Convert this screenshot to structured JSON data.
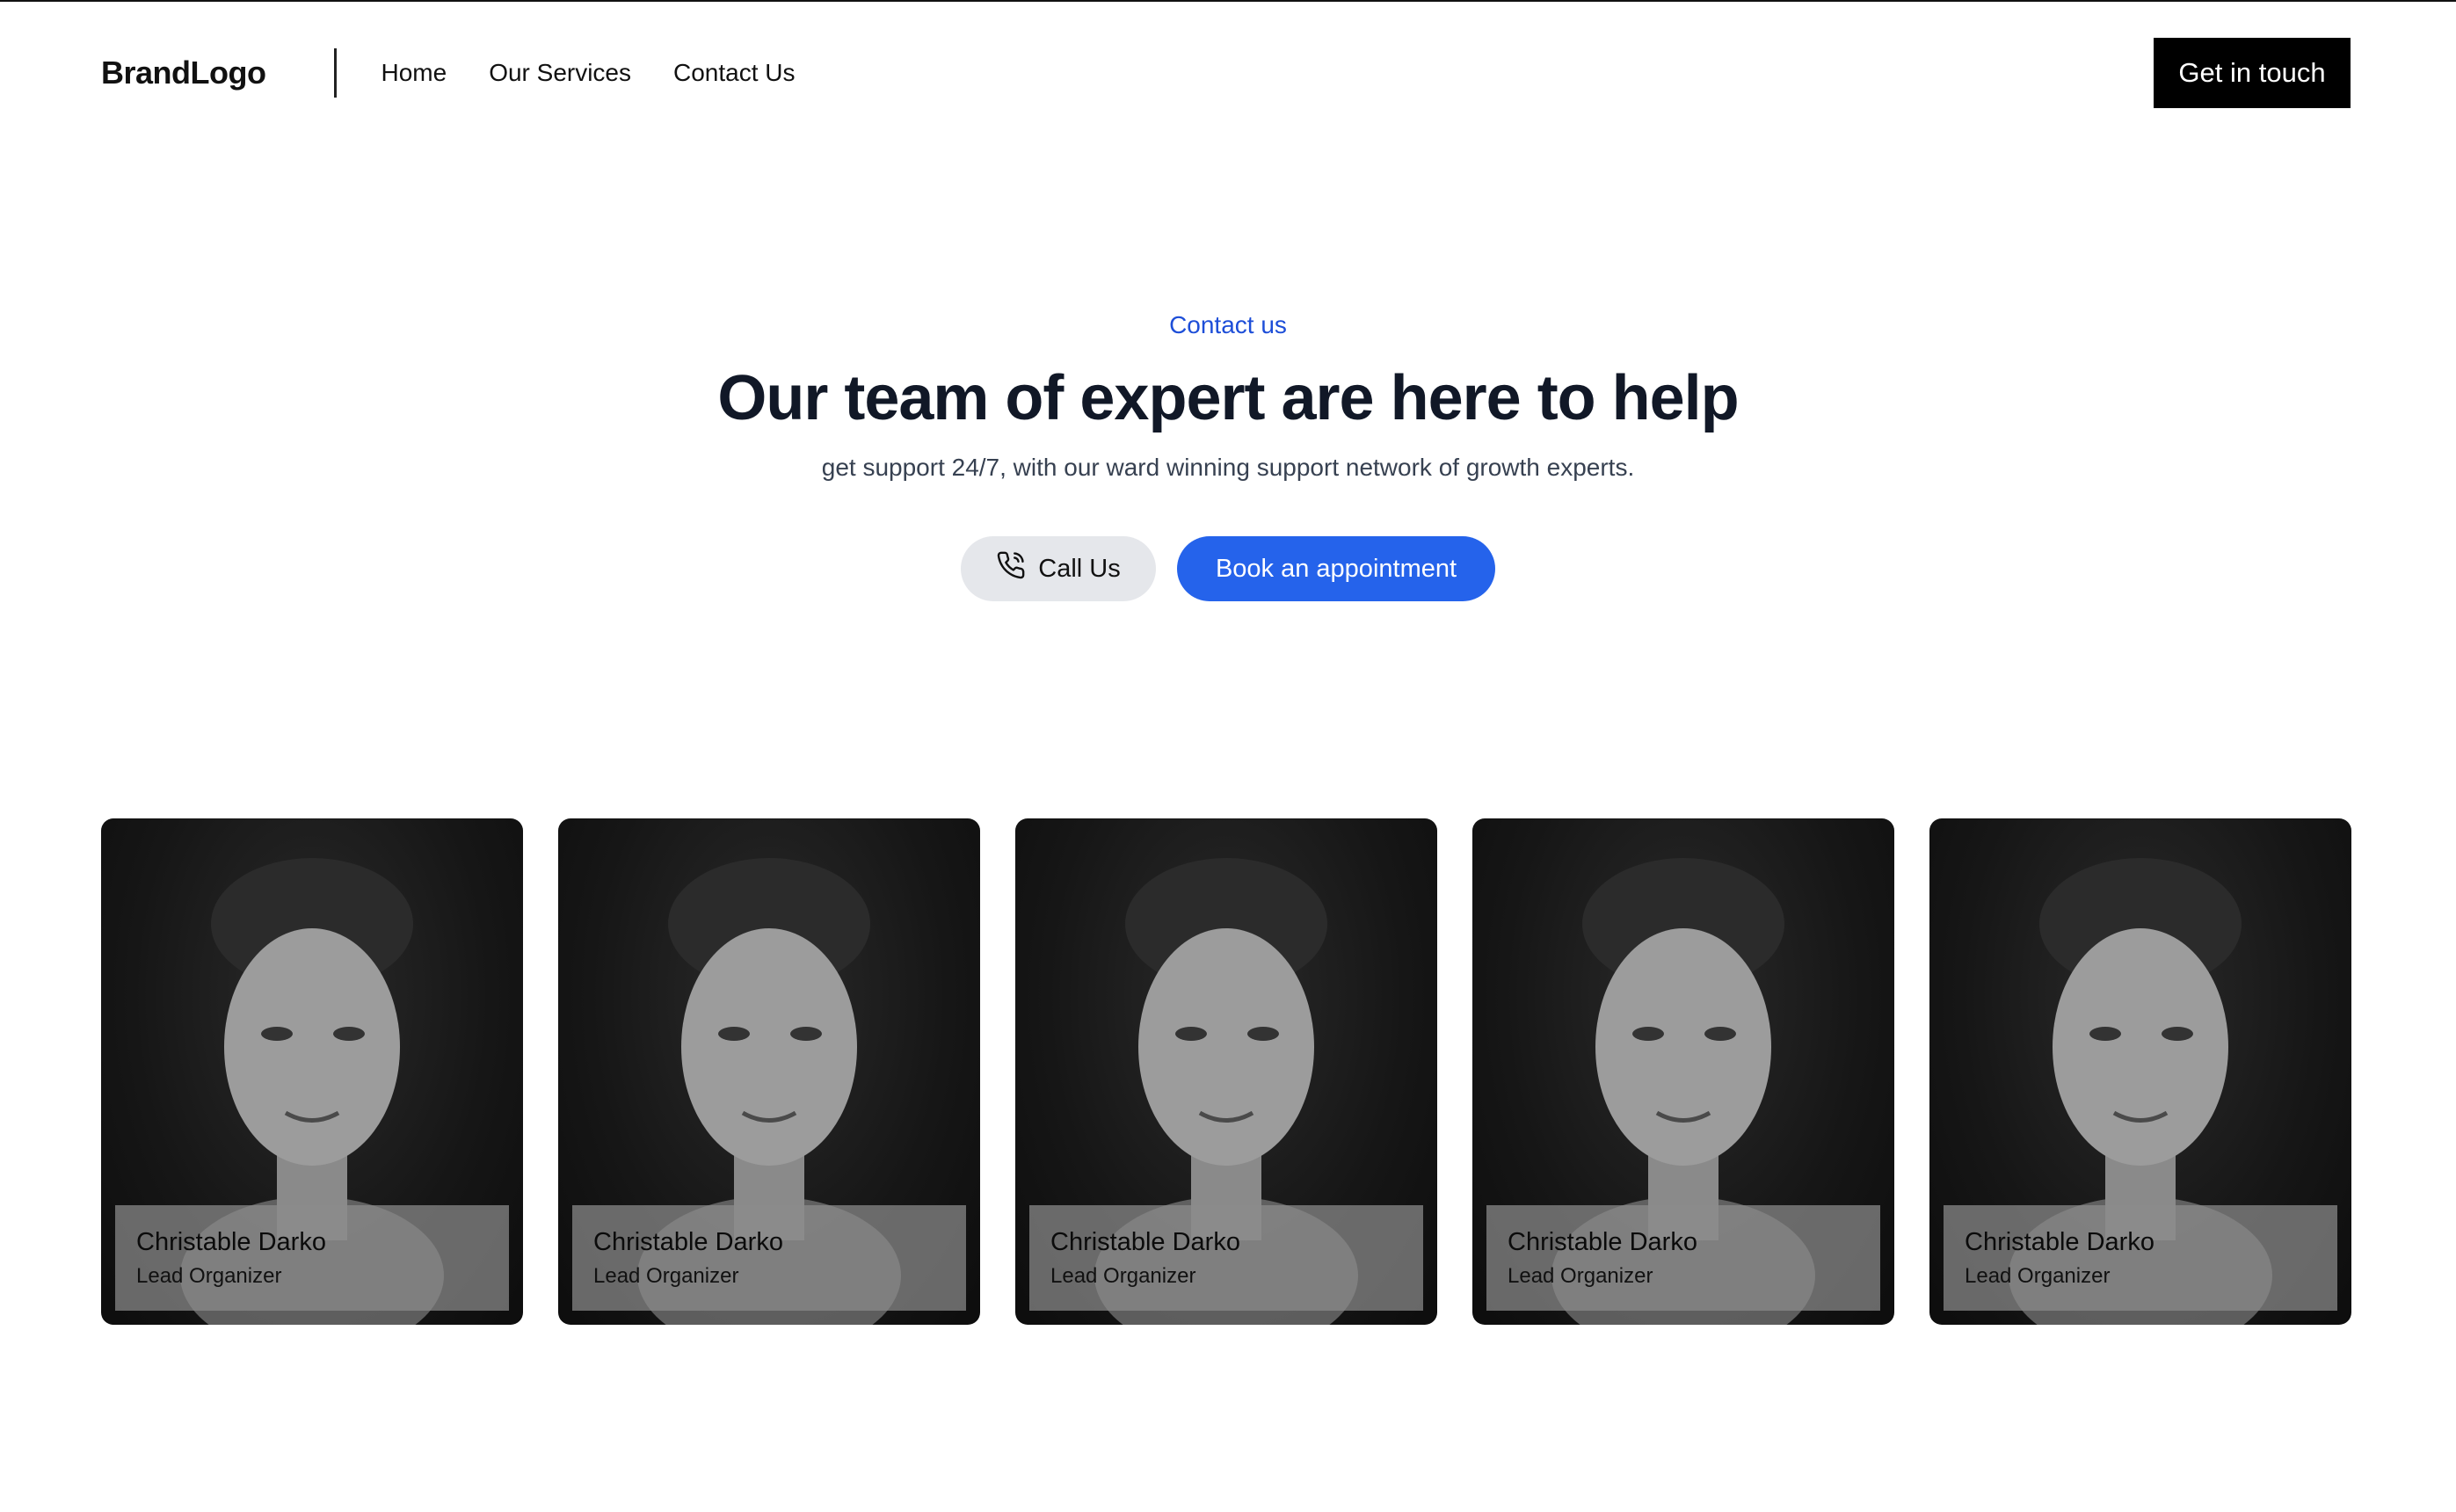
{
  "nav": {
    "logo": "BrandLogo",
    "links": [
      "Home",
      "Our Services",
      "Contact Us"
    ],
    "cta": "Get in touch"
  },
  "hero": {
    "eyebrow": "Contact us",
    "headline": "Our team of expert are here to help",
    "subtitle": "get support 24/7, with our ward winning support network of growth experts.",
    "call_label": "Call Us",
    "book_label": "Book an appointment"
  },
  "colors": {
    "accent": "#2563eb",
    "eyebrow": "#1d4ed8",
    "cta_bg": "#000000"
  },
  "icons": {
    "call_button": "phone-icon"
  },
  "team": [
    {
      "name": "Christable Darko",
      "role": "Lead Organizer"
    },
    {
      "name": "Christable Darko",
      "role": "Lead Organizer"
    },
    {
      "name": "Christable Darko",
      "role": "Lead Organizer"
    },
    {
      "name": "Christable Darko",
      "role": "Lead Organizer"
    },
    {
      "name": "Christable Darko",
      "role": "Lead Organizer"
    }
  ]
}
